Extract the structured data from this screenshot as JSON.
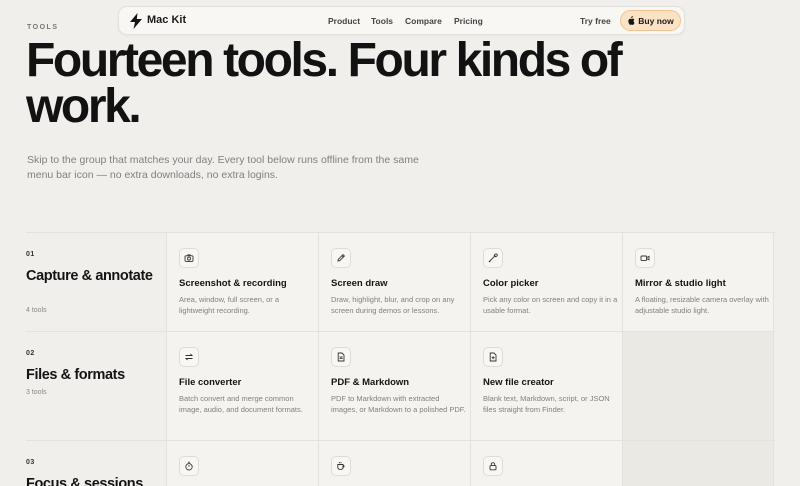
{
  "nav": {
    "brand": "Mac Kit",
    "links": [
      "Product",
      "Tools",
      "Compare",
      "Pricing"
    ],
    "try_free": "Try free",
    "buy_now": "Buy now"
  },
  "hero": {
    "eyebrow": "TOOLS",
    "headline": "Fourteen tools. Four kinds of work.",
    "intro": "Skip to the group that matches your day. Every tool below runs offline from the same menu bar icon — no extra downloads, no extra logins."
  },
  "groups": [
    {
      "num": "01",
      "title": "Capture & annotate",
      "count": "4 tools",
      "tools": [
        {
          "icon": "camera-icon",
          "title": "Screenshot & recording",
          "desc": "Area, window, full screen, or a lightweight recording."
        },
        {
          "icon": "pencil-icon",
          "title": "Screen draw",
          "desc": "Draw, highlight, blur, and crop on any screen during demos or lessons."
        },
        {
          "icon": "eyedropper-icon",
          "title": "Color picker",
          "desc": "Pick any color on screen and copy it in a usable format."
        },
        {
          "icon": "video-icon",
          "title": "Mirror & studio light",
          "desc": "A floating, resizable camera overlay with adjustable studio light."
        }
      ]
    },
    {
      "num": "02",
      "title": "Files & formats",
      "count": "3 tools",
      "tools": [
        {
          "icon": "convert-arrows-icon",
          "title": "File converter",
          "desc": "Batch convert and merge common image, audio, and document formats."
        },
        {
          "icon": "document-icon",
          "title": "PDF & Markdown",
          "desc": "PDF to Markdown with extracted images, or Markdown to a polished PDF."
        },
        {
          "icon": "file-plus-icon",
          "title": "New file creator",
          "desc": "Blank text, Markdown, script, or JSON files straight from Finder."
        }
      ]
    },
    {
      "num": "03",
      "title": "Focus & sessions",
      "tools": [
        {
          "icon": "timer-icon"
        },
        {
          "icon": "coffee-cup-icon"
        },
        {
          "icon": "lock-icon"
        }
      ]
    }
  ]
}
